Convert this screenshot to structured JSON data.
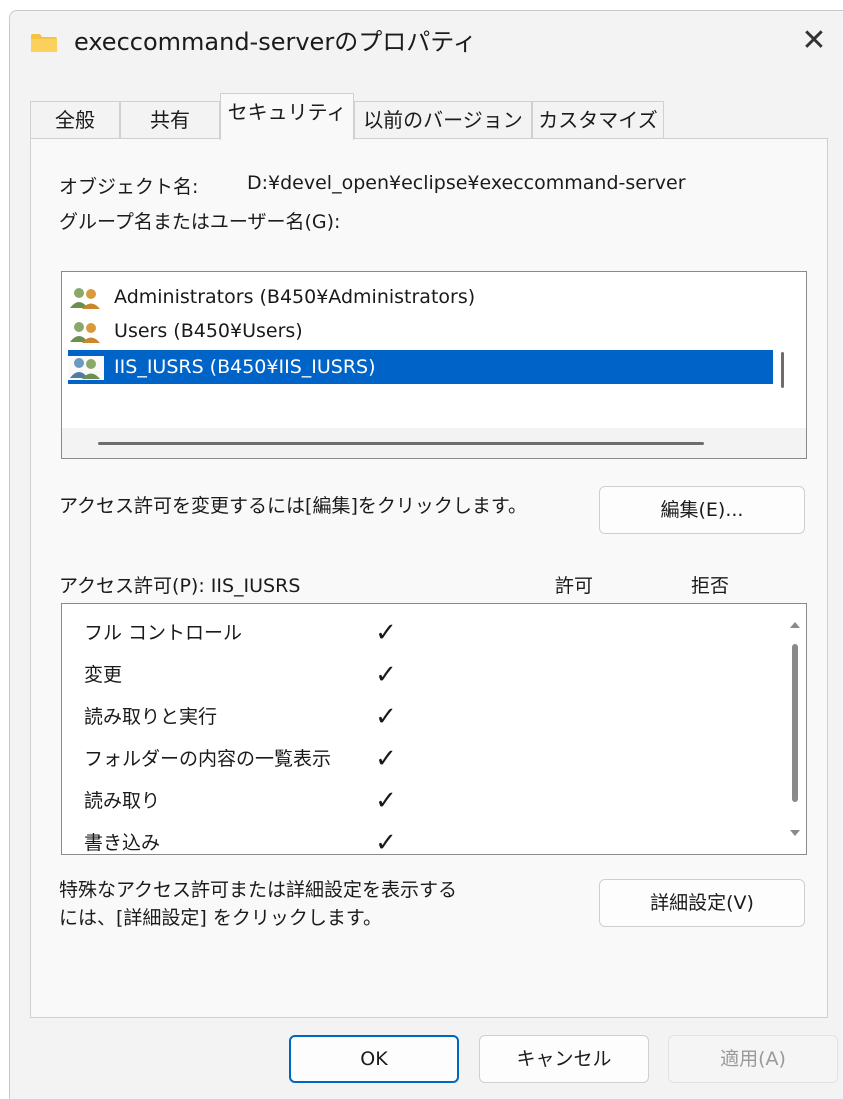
{
  "window": {
    "title": "execcommand-serverのプロパティ",
    "close_glyph": "✕"
  },
  "tabs": [
    {
      "label": "全般",
      "active": false
    },
    {
      "label": "共有",
      "active": false
    },
    {
      "label": "セキュリティ",
      "active": true
    },
    {
      "label": "以前のバージョン",
      "active": false
    },
    {
      "label": "カスタマイズ",
      "active": false
    }
  ],
  "security": {
    "object_name_label": "オブジェクト名:",
    "object_name_value": "D:¥devel_open¥eclipse¥execcommand-server",
    "group_label": "グループ名またはユーザー名(G):",
    "users": [
      {
        "name": "Administrators (B450¥Administrators)",
        "selected": false
      },
      {
        "name": "Users (B450¥Users)",
        "selected": false
      },
      {
        "name": "IIS_IUSRS (B450¥IIS_IUSRS)",
        "selected": true
      }
    ],
    "change_hint": "アクセス許可を変更するには[編集]をクリックします。",
    "edit_button": "編集(E)...",
    "permissions_label": "アクセス許可(P): IIS_IUSRS",
    "allow_header": "許可",
    "deny_header": "拒否",
    "permissions": [
      {
        "name": "フル コントロール",
        "allow": "✓",
        "deny": ""
      },
      {
        "name": "変更",
        "allow": "✓",
        "deny": ""
      },
      {
        "name": "読み取りと実行",
        "allow": "✓",
        "deny": ""
      },
      {
        "name": "フォルダーの内容の一覧表示",
        "allow": "✓",
        "deny": ""
      },
      {
        "name": "読み取り",
        "allow": "✓",
        "deny": ""
      },
      {
        "name": "書き込み",
        "allow": "✓",
        "deny": ""
      }
    ],
    "advanced_hint_line1": "特殊なアクセス許可または詳細設定を表示する",
    "advanced_hint_line2": "には、[詳細設定] をクリックします。",
    "advanced_button": "詳細設定(V)"
  },
  "footer": {
    "ok": "OK",
    "cancel": "キャンセル",
    "apply": "適用(A)"
  },
  "colors": {
    "selection": "#0063c8",
    "accent_border": "#0067c0",
    "folder": "#f6c244"
  }
}
